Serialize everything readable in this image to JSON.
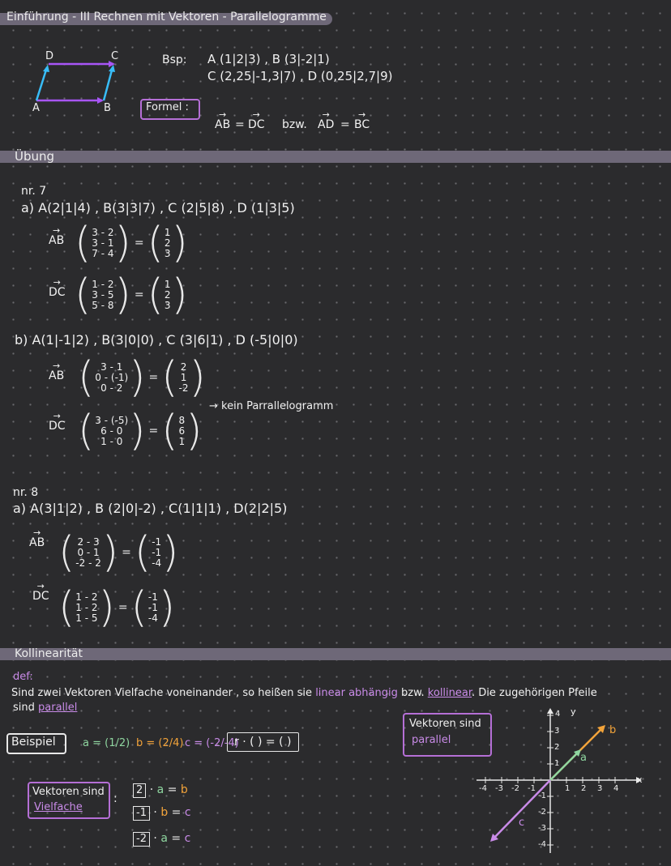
{
  "header": {
    "title": "Einführung - III Rechnen mit Vektoren - Parallelogramme"
  },
  "parallelogram": {
    "labels": [
      "D",
      "C",
      "A",
      "B"
    ]
  },
  "example": {
    "bsp_label": "Bsp:",
    "line1": "A (1|2|3) , B (3|-2|1)",
    "line2": "C (2,25|-1,3|7) , D (0,25|2,7|9)",
    "formula_label": "Formel :",
    "formula_ab": "AB",
    "formula_dc": "DC",
    "formula_bzw": "bzw.",
    "formula_ad": "AD",
    "formula_bc": "BC",
    "equals": "="
  },
  "uebung": {
    "title": "Übung",
    "nr7": "nr. 7",
    "a_line": "a) A(2|1|4) , B(3|3|7) , C (2|5|8) , D (1|3|5)",
    "a_ab_label": "AB",
    "a_ab_rows": [
      "3 - 2",
      "3 - 1",
      "7 - 4"
    ],
    "a_ab_res": [
      "1",
      "2",
      "3"
    ],
    "a_dc_label": "DC",
    "a_dc_rows": [
      "1 - 2",
      "3 - 5",
      "5 - 8"
    ],
    "a_dc_res": [
      "1",
      "2",
      "3"
    ],
    "b_line": "b) A(1|-1|2) , B(3|0|0) , C (3|6|1) , D (-5|0|0)",
    "b_ab_label": "AB",
    "b_ab_rows": [
      "3 - 1",
      "0 - (-1)",
      "0 - 2"
    ],
    "b_ab_res": [
      "2",
      "1",
      "-2"
    ],
    "b_dc_label": "DC",
    "b_dc_rows": [
      "3 - (-5)",
      "6 - 0",
      "1 - 0"
    ],
    "b_dc_res": [
      "8",
      "6",
      "1"
    ],
    "b_note": "→ kein Parrallelogramm",
    "nr8": "nr. 8",
    "c_line": "a) A(3|1|2) , B (2|0|-2) , C(1|1|1) , D(2|2|5)",
    "c_ab_label": "AB",
    "c_ab_rows": [
      "2 - 3",
      "0 - 1",
      "-2 - 2"
    ],
    "c_ab_res": [
      "-1",
      "-1",
      "-4"
    ],
    "c_dc_label": "DC",
    "c_dc_rows": [
      "1 - 2",
      "1 - 2",
      "1 - 5"
    ],
    "c_dc_res": [
      "-1",
      "-1",
      "-4"
    ]
  },
  "kollinearitaet": {
    "title": "Kollinearität",
    "def": "def:",
    "sentence1_a": "Sind zwei Vektoren Vielfache voneinander , so heißen sie ",
    "linear": "linear abhängig",
    "sentence1_b": " bzw. ",
    "kollinear": "kollinear",
    "sentence1_c": ". Die zugehörigen Pfeile",
    "sentence2_a": "sind ",
    "parallel": "parallel",
    "beispiel": "Beispiel",
    "vec_a": "a = (1/2)",
    "vec_b": "b = (2/4)",
    "vec_c": "c = (-2/-4)",
    "template": "r · (  ) = (  )",
    "box_parallel_1": "Vektoren sind",
    "box_parallel_2": "parallel",
    "box_vielfache_1": "Vektoren sind",
    "box_vielfache_2": "Vielfache",
    "rel1_k": "2",
    "rel1_v1": "a",
    "rel1_v2": "b",
    "rel2_k": "-1",
    "rel2_v1": "b",
    "rel2_v2": "c",
    "rel3_k": "-2",
    "rel3_v1": "a",
    "rel3_v2": "c",
    "colors": {
      "a": "#8fd6a0",
      "b": "#f2a33a",
      "c": "#c98be8"
    }
  },
  "graph": {
    "x_label": "x",
    "y_label": "y",
    "x_ticks": [
      "-4",
      "-3",
      "-2",
      "-1",
      "1",
      "2",
      "3",
      "4"
    ],
    "y_ticks": [
      "4",
      "3",
      "2",
      "1",
      "-1",
      "-2",
      "-3",
      "-4"
    ],
    "vec_a_label": "a",
    "vec_b_label": "b",
    "vec_c_label": "c"
  }
}
